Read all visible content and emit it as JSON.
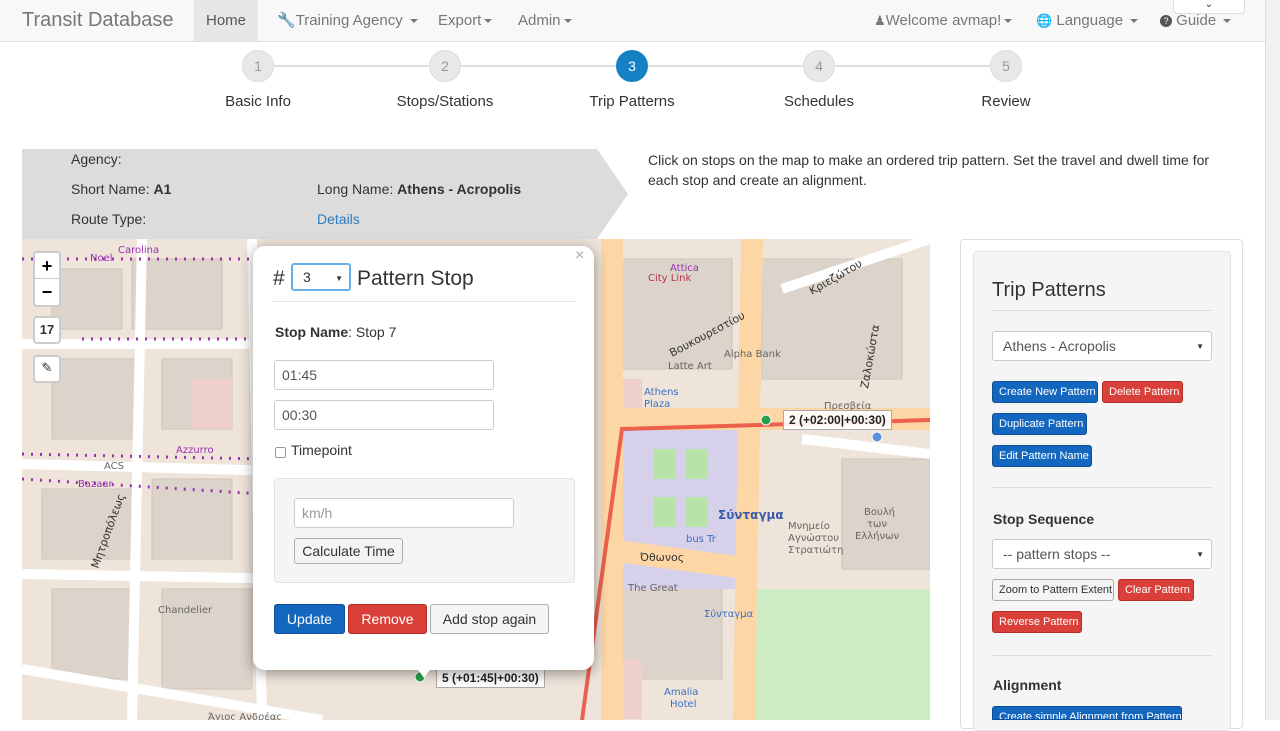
{
  "app": {
    "brand": "Transit Database"
  },
  "nav": {
    "home": "Home",
    "training_agency": "Training Agency",
    "export": "Export",
    "admin": "Admin",
    "welcome": "Welcome avmap!",
    "language": "Language",
    "guide": "Guide"
  },
  "wizard": {
    "steps": [
      {
        "num": "1",
        "label": "Basic Info"
      },
      {
        "num": "2",
        "label": "Stops/Stations"
      },
      {
        "num": "3",
        "label": "Trip Patterns"
      },
      {
        "num": "4",
        "label": "Schedules"
      },
      {
        "num": "5",
        "label": "Review"
      }
    ],
    "active_step": 3
  },
  "route_info": {
    "agency_label": "Agency:",
    "agency_value": "",
    "short_name_label": "Short Name:",
    "short_name_value": "A1",
    "long_name_label": "Long Name:",
    "long_name_value": "Athens - Acropolis",
    "route_type_label": "Route Type:",
    "details_link": "Details"
  },
  "instructions": "Click on stops on the map to make an ordered trip pattern. Set the travel and dwell time for each stop and create an alignment.",
  "map": {
    "zoom_in": "+",
    "zoom_out": "−",
    "zoom_level": "17",
    "stop_labels": [
      "2 (+02:00|+00:30)",
      "5 (+01:45|+00:30)"
    ],
    "place_names": [
      "Σύνταγμα",
      "Carolina",
      "Noel",
      "City Link",
      "Attica",
      "Alpha Bank",
      "Latte Art",
      "Athens Plaza",
      "Azzurro",
      "ACS",
      "Bazaar",
      "Chandelier",
      "Άγιος Ανδρέας",
      "The Great",
      "Amalia Hotel",
      "Βουλή των Ελλήνων",
      "Μνημείο Αγνώστου Στρατιώτη",
      "bus Tr",
      "Όθωνος",
      "Βουκουρεστίου",
      "Κριεζώτου",
      "Ζαλοκώστα",
      "Μητροπόλεως",
      "Σύνταγμα",
      "Πρεσβεία της Αγγλίας"
    ]
  },
  "popup": {
    "hash": "#",
    "sequence_value": "3",
    "title": "Pattern Stop",
    "stop_name_label": "Stop Name",
    "stop_name_value": "Stop 7",
    "travel_time": "01:45",
    "dwell_time": "00:30",
    "timepoint_label": "Timepoint",
    "speed_placeholder": "km/h",
    "calculate_button": "Calculate Time",
    "update_button": "Update",
    "remove_button": "Remove",
    "add_again_button": "Add stop again",
    "close": "×"
  },
  "panel": {
    "title": "Trip Patterns",
    "pattern_select": "Athens - Acropolis",
    "create_button": "Create New Pattern",
    "delete_button": "Delete Pattern",
    "duplicate_button": "Duplicate Pattern",
    "edit_name_button": "Edit Pattern Name",
    "stop_sequence_heading": "Stop Sequence",
    "stop_sequence_select": "-- pattern stops --",
    "zoom_extent_button": "Zoom to Pattern Extent",
    "clear_button": "Clear Pattern",
    "reverse_button": "Reverse Pattern",
    "alignment_heading": "Alignment",
    "alignment_button": "Create simple Alignment from Pattern"
  },
  "colors": {
    "primary": "#1467bf",
    "danger": "#d9403a",
    "active_step": "#1680c4",
    "route_line": "#e74c3c"
  }
}
